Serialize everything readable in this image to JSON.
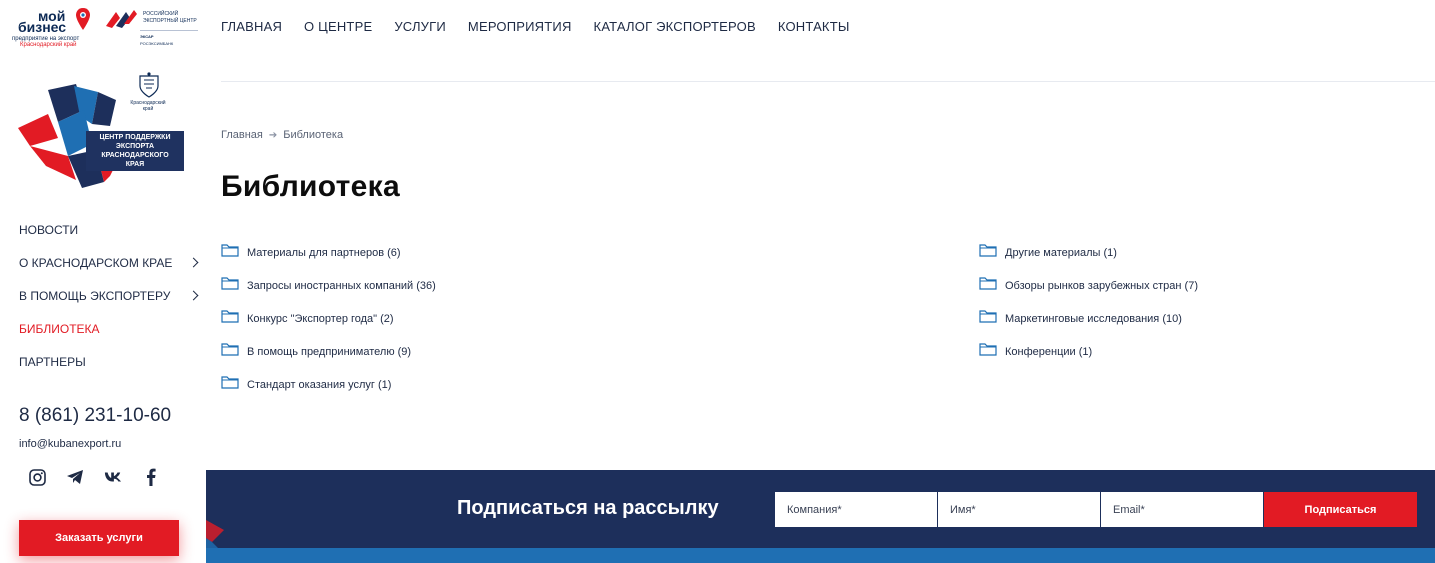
{
  "logos": {
    "moy_biznes": {
      "line1": "мой",
      "line2": "бизнес",
      "line3": "предприятие на экспорт",
      "line4": "Краснодарский край"
    },
    "rec": {
      "line1": "РОССИЙСКИЙ",
      "line2": "ЭКСПОРТНЫЙ ЦЕНТР",
      "line3": "ЭКСАР",
      "line4": "РОСЭКСИМБАНК"
    },
    "center": {
      "caption_1": "ЦЕНТР ПОДДЕРЖКИ",
      "caption_2": "ЭКСПОРТА",
      "caption_3": "КРАСНОДАРСКОГО КРАЯ",
      "region_1": "Краснодарский",
      "region_2": "край"
    }
  },
  "topnav": [
    {
      "label": "ГЛАВНАЯ"
    },
    {
      "label": "О ЦЕНТРЕ"
    },
    {
      "label": "УСЛУГИ"
    },
    {
      "label": "МЕРОПРИЯТИЯ"
    },
    {
      "label": "КАТАЛОГ ЭКСПОРТЕРОВ"
    },
    {
      "label": "КОНТАКТЫ"
    }
  ],
  "sidebar": {
    "items": [
      {
        "label": "НОВОСТИ",
        "has_submenu": false,
        "active": false
      },
      {
        "label": "О КРАСНОДАРСКОМ КРАЕ",
        "has_submenu": true,
        "active": false
      },
      {
        "label": "В ПОМОЩЬ ЭКСПОРТЕРУ",
        "has_submenu": true,
        "active": false
      },
      {
        "label": "БИБЛИОТЕКА",
        "has_submenu": false,
        "active": true
      },
      {
        "label": "ПАРТНЕРЫ",
        "has_submenu": false,
        "active": false
      }
    ],
    "phone": "8 (861) 231-10-60",
    "email": "info@kubanexport.ru",
    "socials": [
      "instagram-icon",
      "telegram-icon",
      "vk-icon",
      "facebook-icon"
    ],
    "order_button": "Заказать услуги"
  },
  "breadcrumb": {
    "home": "Главная",
    "current": "Библиотека"
  },
  "page_title": "Библиотека",
  "folders_left": [
    {
      "label": "Материалы для партнеров (6)"
    },
    {
      "label": "Запросы иностранных компаний (36)"
    },
    {
      "label": "Конкурс \"Экспортер года\" (2)"
    },
    {
      "label": "В помощь предпринимателю (9)"
    },
    {
      "label": "Стандарт оказания услуг (1)"
    }
  ],
  "folders_right": [
    {
      "label": "Другие материалы (1)"
    },
    {
      "label": "Обзоры рынков зарубежных стран (7)"
    },
    {
      "label": "Маркетинговые исследования (10)"
    },
    {
      "label": "Конференции (1)"
    }
  ],
  "subscribe": {
    "title": "Подписаться на рассылку",
    "company_placeholder": "Компания*",
    "name_placeholder": "Имя*",
    "email_placeholder": "Email*",
    "button": "Подписаться"
  },
  "colors": {
    "accent_red": "#e21b24",
    "navy": "#1d2f5b",
    "folder_blue": "#1f6fb3"
  }
}
